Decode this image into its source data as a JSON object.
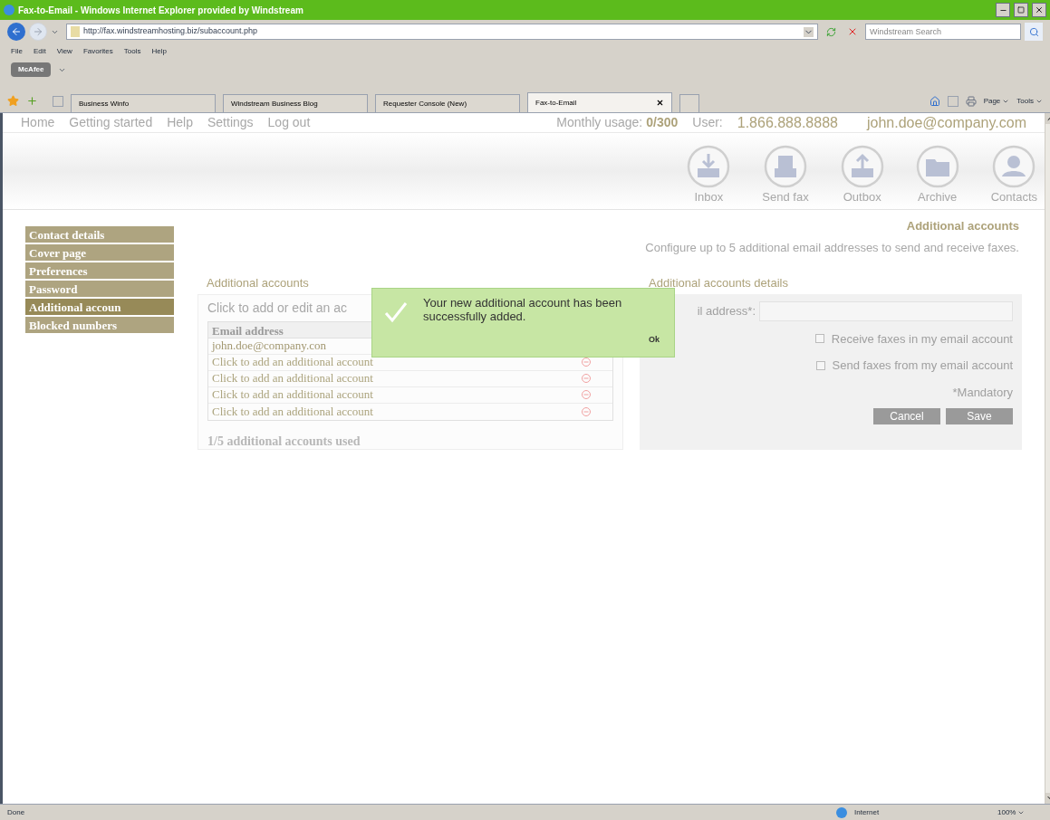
{
  "window": {
    "title": "Fax-to-Email - Windows Internet Explorer provided by Windstream"
  },
  "address_bar": {
    "url": "http://fax.windstreamhosting.biz/subaccount.php"
  },
  "search": {
    "placeholder": "Windstream Search"
  },
  "menu": [
    "File",
    "Edit",
    "View",
    "Favorites",
    "Tools",
    "Help"
  ],
  "toolbar": {
    "mcafee": "McAfee"
  },
  "tabs": [
    {
      "label": "Business Winfo",
      "selected": false
    },
    {
      "label": "Windstream Business Blog",
      "selected": false
    },
    {
      "label": "Requester Console (New)",
      "selected": false
    },
    {
      "label": "Fax-to-Email",
      "selected": true
    }
  ],
  "command_bar": [
    "Page",
    "Tools"
  ],
  "site_nav": {
    "items": [
      "Home",
      "Getting started",
      "Help",
      "Settings",
      "Log out"
    ],
    "usage_label": "Monthly usage:",
    "usage": "0/300",
    "user_label": "User:",
    "phone": "1.866.888.8888",
    "email": "john.doe@company.com"
  },
  "app_icons": [
    {
      "label": "Inbox",
      "kind": "inbox"
    },
    {
      "label": "Send fax",
      "kind": "send"
    },
    {
      "label": "Outbox",
      "kind": "outbox"
    },
    {
      "label": "Archive",
      "kind": "archive"
    },
    {
      "label": "Contacts",
      "kind": "contacts"
    }
  ],
  "page_title": "Additional accounts",
  "page_subtitle": "Configure up to 5 additional email addresses to send and receive faxes.",
  "sidebar": [
    {
      "label": "Contact details",
      "selected": false
    },
    {
      "label": "Cover page",
      "selected": false
    },
    {
      "label": "Preferences",
      "selected": false
    },
    {
      "label": "Password",
      "selected": false
    },
    {
      "label": "Additional accoun",
      "selected": true
    },
    {
      "label": "Blocked numbers",
      "selected": false
    }
  ],
  "accounts": {
    "heading": "Additional accounts",
    "hint": "Click to add or edit an ac",
    "column": "Email address",
    "rows": [
      {
        "text": "john.doe@company.con",
        "kind": "account"
      },
      {
        "text": "Click to add an additional account",
        "kind": "empty"
      },
      {
        "text": "Click to add an additional account",
        "kind": "empty"
      },
      {
        "text": "Click to add an additional account",
        "kind": "empty"
      },
      {
        "text": "Click to add an additional account",
        "kind": "empty"
      }
    ],
    "footer": "1/5 additional accounts used"
  },
  "details": {
    "heading": "Additional accounts details",
    "email_label": "il address*:",
    "checkboxes": [
      {
        "label": "Receive faxes in my email account",
        "checked": false
      },
      {
        "label": "Send faxes from my email account",
        "checked": false
      }
    ],
    "mandatory": "*Mandatory",
    "buttons": [
      "Cancel",
      "Save"
    ]
  },
  "popup": {
    "message": "Your new additional account has been successfully added.",
    "ok": "Ok"
  },
  "status_bar": {
    "text": "Done",
    "zone": "Internet",
    "zoom": "100%"
  }
}
